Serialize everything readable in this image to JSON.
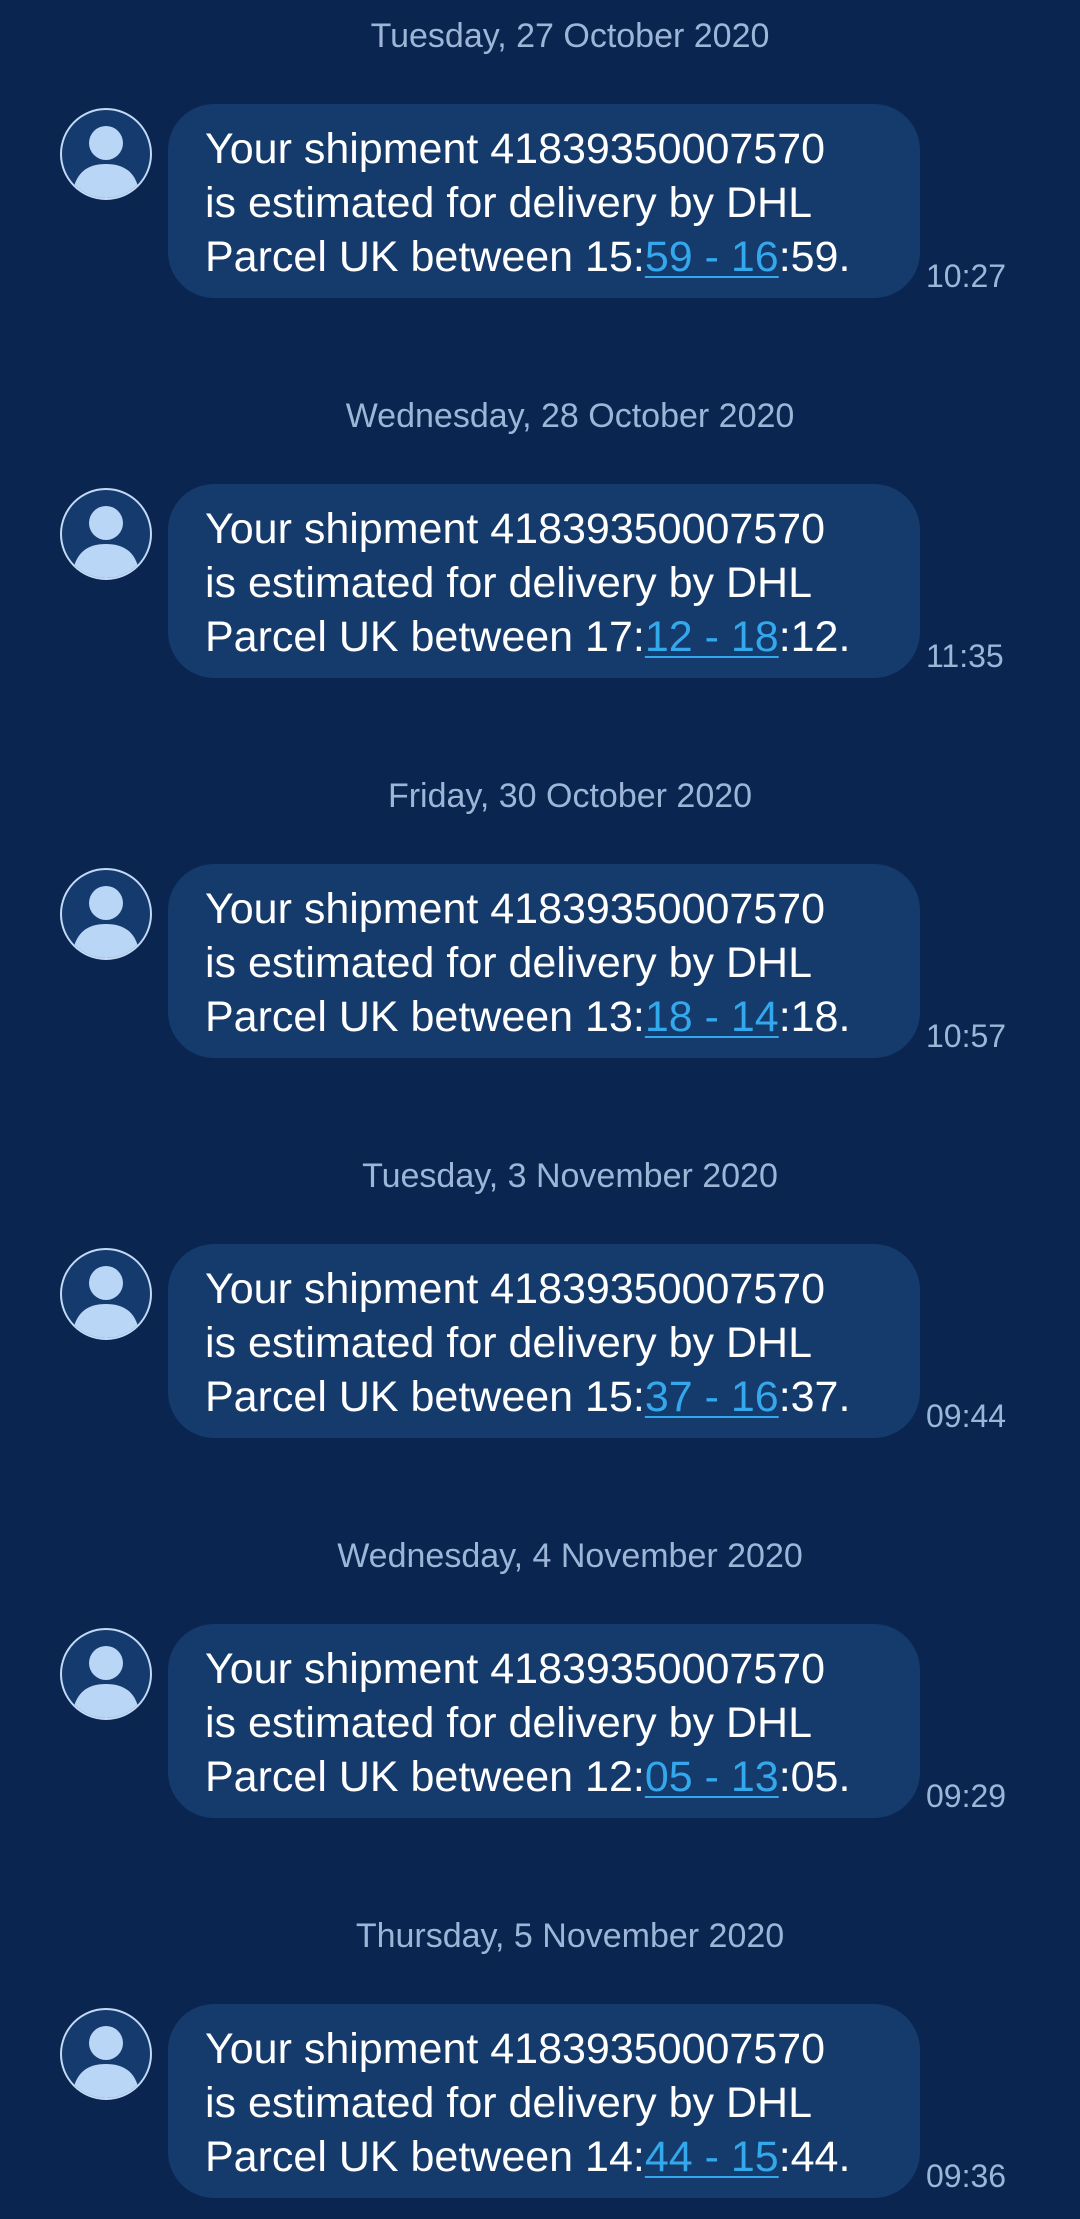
{
  "messages": [
    {
      "date": "Tuesday, 27 October 2020",
      "line1": "Your shipment 41839350007570",
      "line2": "is estimated for delivery by DHL",
      "line3_prefix": "Parcel UK between 15:",
      "link_text": "59 - 16",
      "line3_suffix": ":59.",
      "time": "10:27"
    },
    {
      "date": "Wednesday, 28 October 2020",
      "line1": "Your shipment 41839350007570",
      "line2": "is estimated for delivery by DHL",
      "line3_prefix": "Parcel UK between 17:",
      "link_text": "12 - 18",
      "line3_suffix": ":12.",
      "time": "11:35"
    },
    {
      "date": "Friday, 30 October 2020",
      "line1": "Your shipment 41839350007570",
      "line2": "is estimated for delivery by DHL",
      "line3_prefix": "Parcel UK between 13:",
      "link_text": "18 - 14",
      "line3_suffix": ":18.",
      "time": "10:57"
    },
    {
      "date": "Tuesday, 3 November 2020",
      "line1": "Your shipment 41839350007570",
      "line2": "is estimated for delivery by DHL",
      "line3_prefix": "Parcel UK between 15:",
      "link_text": "37 - 16",
      "line3_suffix": ":37.",
      "time": "09:44"
    },
    {
      "date": "Wednesday, 4 November 2020",
      "line1": "Your shipment 41839350007570",
      "line2": "is estimated for delivery by DHL",
      "line3_prefix": "Parcel UK between 12:",
      "link_text": "05 - 13",
      "line3_suffix": ":05.",
      "time": "09:29"
    },
    {
      "date": "Thursday, 5 November 2020",
      "line1": "Your shipment 41839350007570",
      "line2": "is estimated for delivery by DHL",
      "line3_prefix": "Parcel UK between 14:",
      "link_text": "44 - 15",
      "line3_suffix": ":44.",
      "time": "09:36"
    }
  ],
  "colors": {
    "background": "#0a2550",
    "bubble": "#153a6c",
    "link": "#34a8ec",
    "muted_text": "#9db6d8",
    "avatar_silhouette": "#b9d6f7"
  },
  "icons": {
    "avatar": "contact-avatar-icon"
  }
}
